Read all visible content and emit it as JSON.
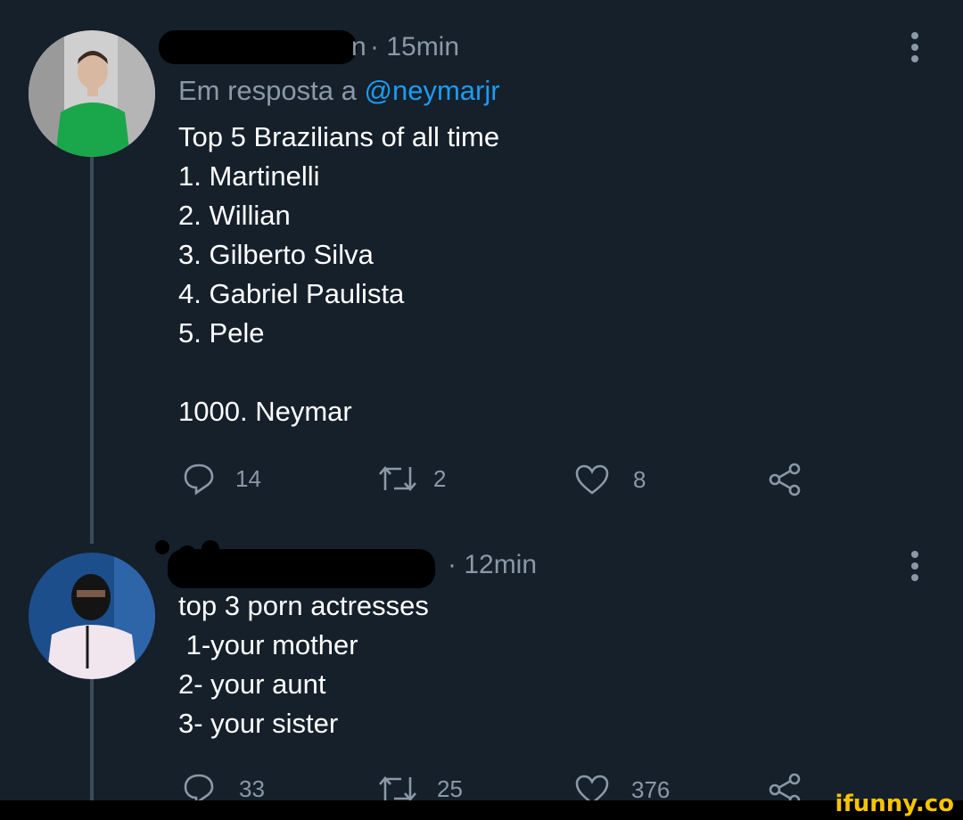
{
  "tweets": [
    {
      "time": "· 15min",
      "name_visible_fragment": "n",
      "reply_prefix": "Em resposta a",
      "reply_handle": "@neymarjr",
      "lines": [
        "Top 5 Brazilians of all time",
        "1. Martinelli",
        "2. Willian",
        "3. Gilberto Silva",
        "4. Gabriel Paulista",
        "5. Pele",
        "",
        "1000. Neymar"
      ],
      "replies": "14",
      "retweets": "2",
      "likes": "8"
    },
    {
      "time": "· 12min",
      "lines": [
        "top 3 porn actresses",
        " 1-your mother",
        "2- your aunt",
        "3- your sister"
      ],
      "replies": "33",
      "retweets": "25",
      "likes": "376"
    }
  ],
  "icons": [
    "reply-icon",
    "retweet-icon",
    "like-icon",
    "share-icon",
    "more-icon"
  ],
  "colors": {
    "background": "#15202b",
    "text": "#ffffff",
    "muted": "#8b98a5",
    "link": "#1d9bf0",
    "brand": "#f6c300"
  },
  "watermark": "ifunny.co"
}
